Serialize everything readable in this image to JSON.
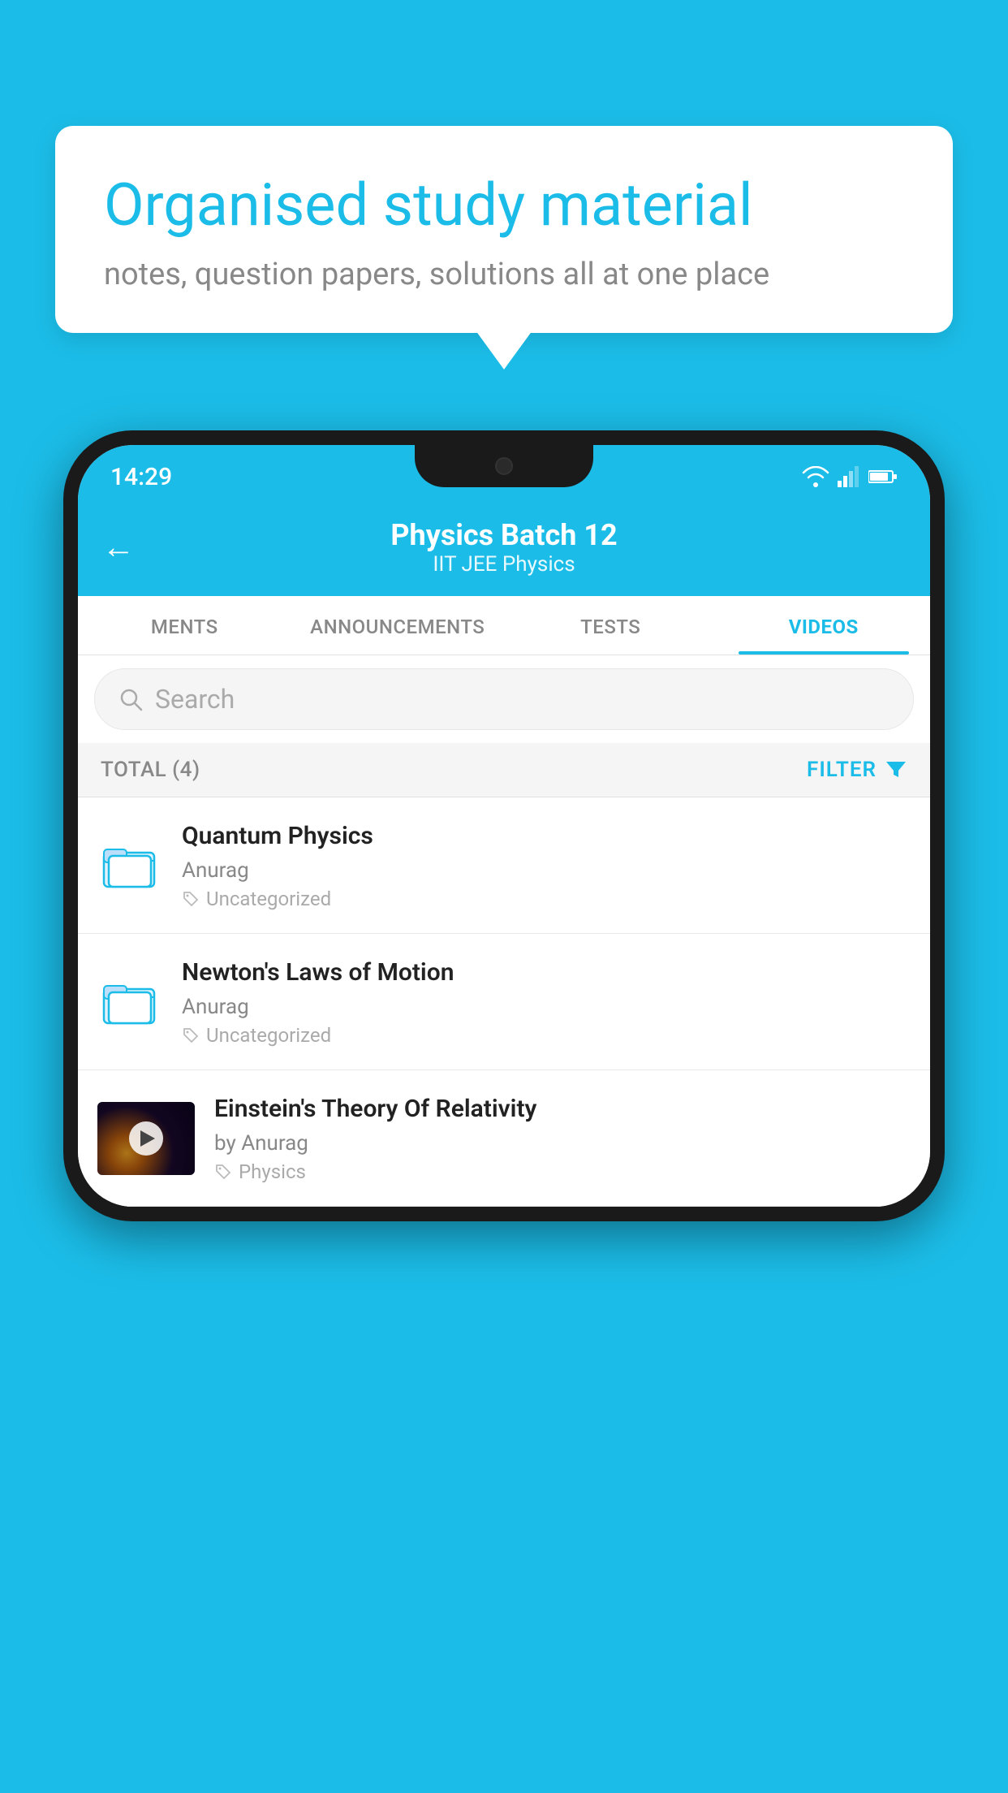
{
  "background_color": "#1BBDE8",
  "bubble": {
    "title": "Organised study material",
    "subtitle": "notes, question papers, solutions all at one place"
  },
  "status_bar": {
    "time": "14:29"
  },
  "header": {
    "title": "Physics Batch 12",
    "subtitle": "IIT JEE   Physics",
    "back_label": "←"
  },
  "tabs": [
    {
      "label": "MENTS",
      "active": false
    },
    {
      "label": "ANNOUNCEMENTS",
      "active": false
    },
    {
      "label": "TESTS",
      "active": false
    },
    {
      "label": "VIDEOS",
      "active": true
    }
  ],
  "search": {
    "placeholder": "Search"
  },
  "filter_bar": {
    "total_label": "TOTAL (4)",
    "filter_label": "FILTER"
  },
  "videos": [
    {
      "title": "Quantum Physics",
      "author": "Anurag",
      "tag": "Uncategorized",
      "has_thumbnail": false
    },
    {
      "title": "Newton's Laws of Motion",
      "author": "Anurag",
      "tag": "Uncategorized",
      "has_thumbnail": false
    },
    {
      "title": "Einstein's Theory Of Relativity",
      "author": "by Anurag",
      "tag": "Physics",
      "has_thumbnail": true
    }
  ]
}
